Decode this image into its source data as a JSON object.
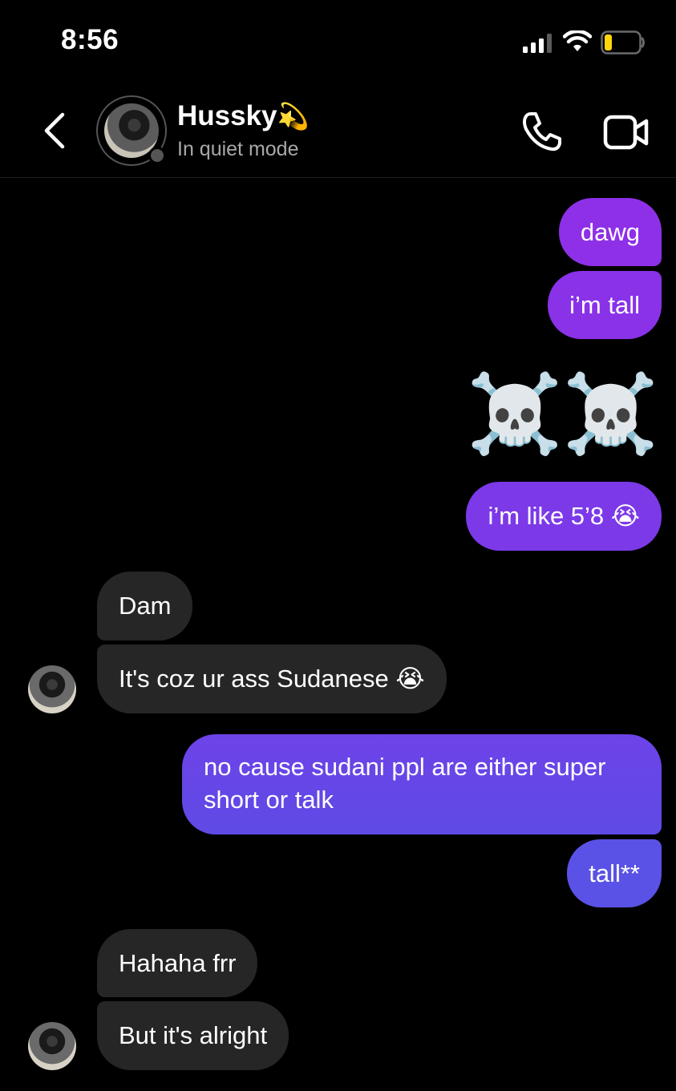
{
  "status_bar": {
    "time": "8:56",
    "icons": [
      "cellular-signal-icon",
      "wifi-icon",
      "battery-low-icon"
    ],
    "battery_color": "#ffd60a"
  },
  "header": {
    "contact_name": "Hussky",
    "name_emoji": "💫",
    "status": "In quiet mode",
    "icons": [
      "back-chevron-icon",
      "phone-icon",
      "video-camera-icon"
    ]
  },
  "colors": {
    "background": "#000000",
    "incoming_bubble": "#262626",
    "outgoing_gradient_top": "#8a33e6",
    "outgoing_gradient_bottom": "#5a52e6"
  },
  "messages": [
    {
      "dir": "out",
      "text": "dawg"
    },
    {
      "dir": "out",
      "text": "i’m tall"
    },
    {
      "dir": "out",
      "text": "☠️☠️",
      "emoji_only": true
    },
    {
      "dir": "out",
      "text": "i’m like 5’8 😭"
    },
    {
      "dir": "in",
      "text": "Dam"
    },
    {
      "dir": "in",
      "text": "It's coz ur ass Sudanese 😭"
    },
    {
      "dir": "out",
      "text": "no cause sudani ppl are either super short or talk"
    },
    {
      "dir": "out",
      "text": "tall**"
    },
    {
      "dir": "in",
      "text": "Hahaha frr"
    },
    {
      "dir": "in",
      "text": "But it's alright"
    }
  ]
}
